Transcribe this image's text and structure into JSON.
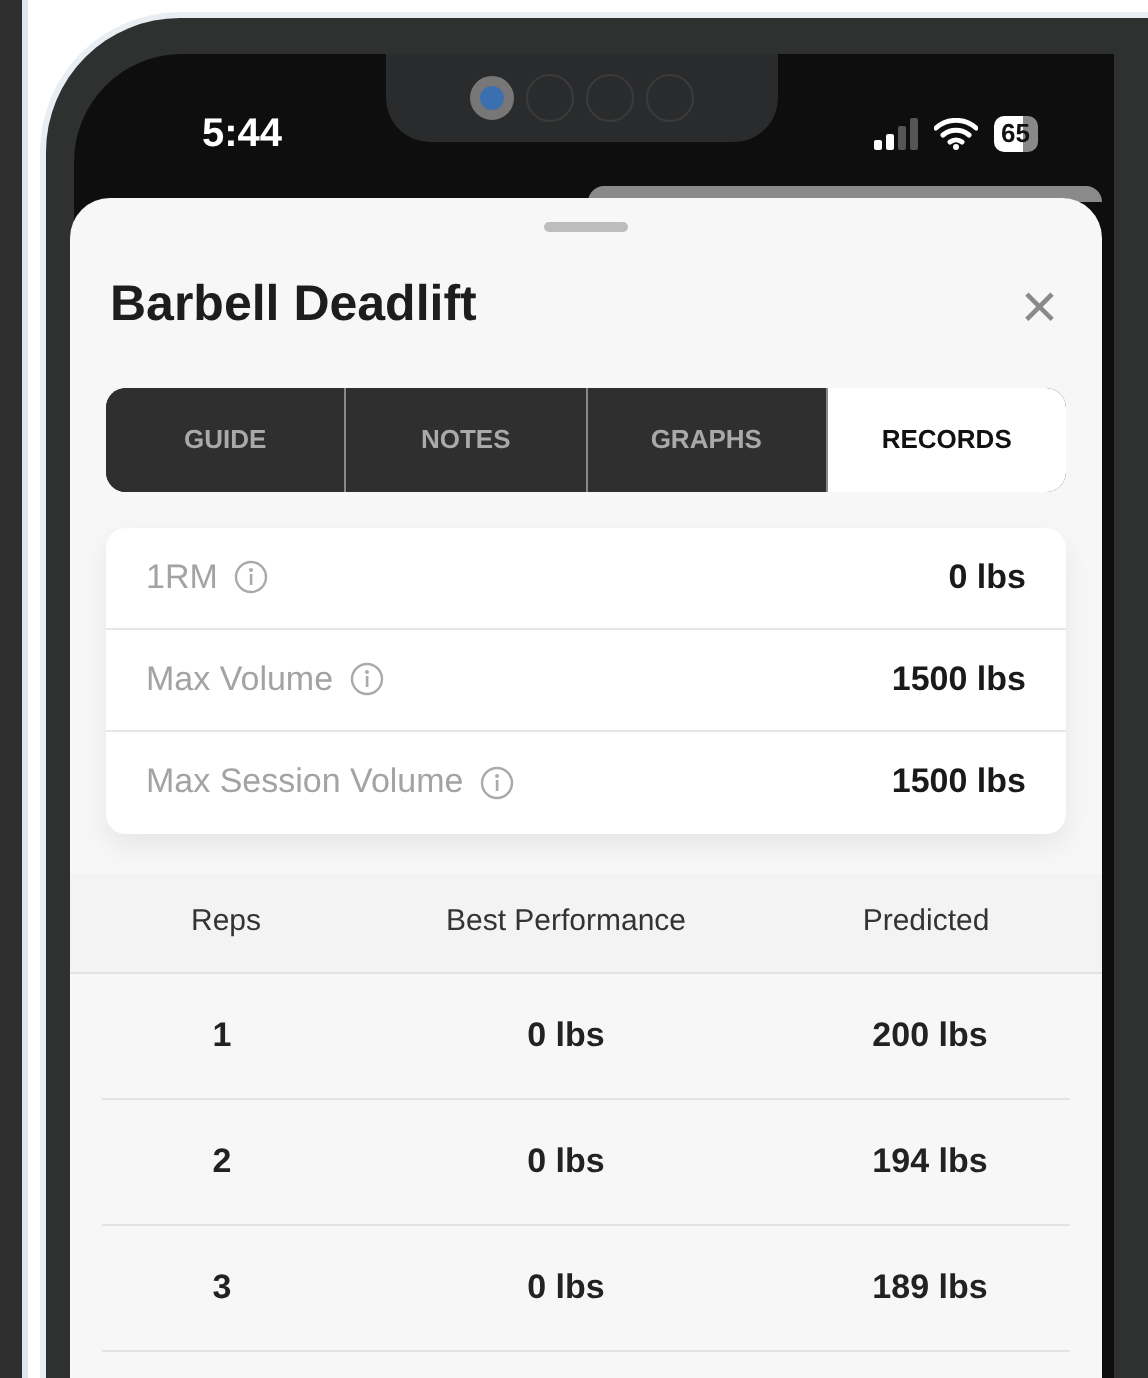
{
  "status_bar": {
    "time": "5:44",
    "battery": "65"
  },
  "sheet": {
    "title": "Barbell Deadlift",
    "close": "×"
  },
  "tabs": [
    {
      "label": "GUIDE",
      "selected": false
    },
    {
      "label": "NOTES",
      "selected": false
    },
    {
      "label": "GRAPHS",
      "selected": false
    },
    {
      "label": "RECORDS",
      "selected": true
    }
  ],
  "stats": [
    {
      "label": "1RM",
      "value": "0 lbs"
    },
    {
      "label": "Max Volume",
      "value": "1500 lbs"
    },
    {
      "label": "Max Session Volume",
      "value": "1500 lbs"
    }
  ],
  "table": {
    "columns": [
      "Reps",
      "Best Performance",
      "Predicted"
    ],
    "rows": [
      [
        "1",
        "0 lbs",
        "200 lbs"
      ],
      [
        "2",
        "0 lbs",
        "194 lbs"
      ],
      [
        "3",
        "0 lbs",
        "189 lbs"
      ]
    ]
  }
}
